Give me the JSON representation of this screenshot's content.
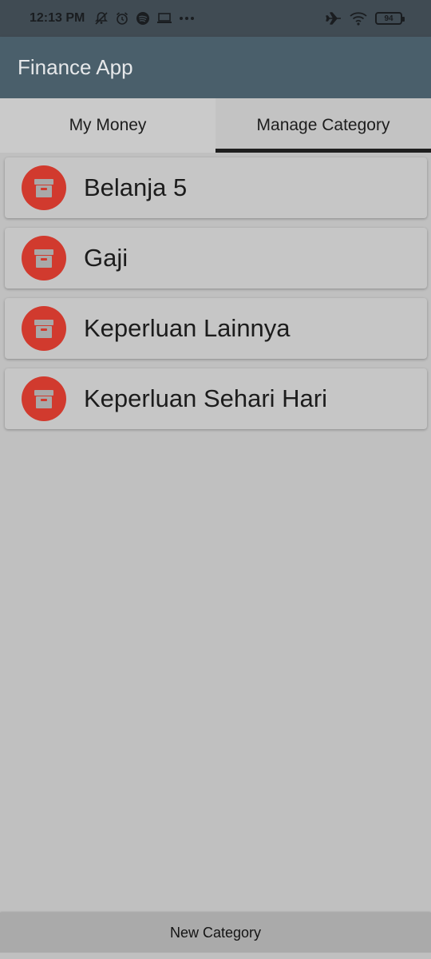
{
  "status_bar": {
    "time": "12:13 PM",
    "battery": "94",
    "icons_left": [
      "notifications-off-icon",
      "alarm-icon",
      "spotify-icon",
      "laptop-icon",
      "more-dots-icon"
    ],
    "icons_right": [
      "airplane-icon",
      "wifi-icon",
      "battery-icon"
    ]
  },
  "app_bar": {
    "title": "Finance App"
  },
  "tabs": [
    {
      "label": "My Money",
      "selected": false
    },
    {
      "label": "Manage Category",
      "selected": true
    }
  ],
  "categories": [
    {
      "label": "Belanja 5",
      "icon": "archive-box-icon"
    },
    {
      "label": "Gaji",
      "icon": "archive-box-icon"
    },
    {
      "label": "Keperluan Lainnya",
      "icon": "archive-box-icon"
    },
    {
      "label": "Keperluan Sehari Hari",
      "icon": "archive-box-icon"
    }
  ],
  "footer": {
    "new_category_label": "New Category"
  },
  "colors": {
    "status_bar": "#404b53",
    "app_bar": "#4a5f6b",
    "background": "#c0c0c0",
    "avatar": "#d13a2e",
    "footer_button": "#aaaaaa"
  }
}
